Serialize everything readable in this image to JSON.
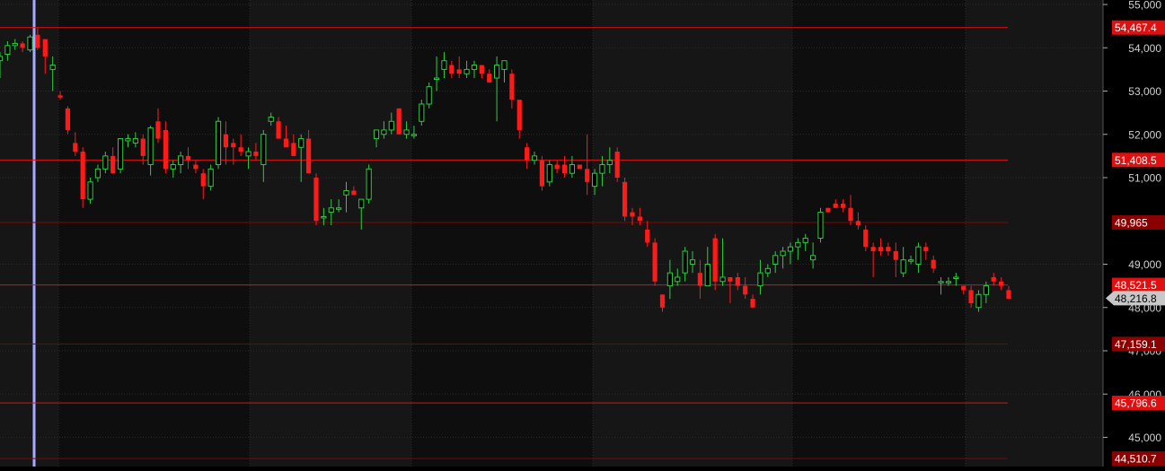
{
  "chart_data": {
    "type": "candlestick",
    "title": "",
    "xlabel": "",
    "ylabel": "",
    "ylim": [
      44500,
      55000
    ],
    "grid": true,
    "y_ticks": [
      {
        "value": 55000,
        "label": "55,000"
      },
      {
        "value": 54000,
        "label": "54,000"
      },
      {
        "value": 53000,
        "label": "53,000"
      },
      {
        "value": 52000,
        "label": "52,000"
      },
      {
        "value": 51000,
        "label": "51,000"
      },
      {
        "value": 49000,
        "label": "49,000"
      },
      {
        "value": 48000,
        "label": "48,000"
      },
      {
        "value": 47000,
        "label": "47,000"
      },
      {
        "value": 46000,
        "label": "46,000"
      },
      {
        "value": 45000,
        "label": "45,000"
      }
    ],
    "horizontal_levels": [
      {
        "value": 54467,
        "label": "54,467.4",
        "color": "#e01010"
      },
      {
        "value": 51408,
        "label": "51,408.5",
        "color": "#e01010"
      },
      {
        "value": 49965,
        "label": "49,965",
        "color": "#8b0000"
      },
      {
        "value": 48521,
        "label": "48,521.5",
        "color": "#e01010"
      },
      {
        "value": 47159,
        "label": "47,159.1",
        "color": "#8b0000"
      },
      {
        "value": 45796,
        "label": "45,796.6",
        "color": "#e01010"
      },
      {
        "value": 44510,
        "label": "44,510.7",
        "color": "#8b0000"
      }
    ],
    "last_price": {
      "value": 48216,
      "label": "48,216.8"
    },
    "candles": [
      [
        53700,
        53900,
        53300,
        53800
      ],
      [
        53850,
        54150,
        53700,
        54050
      ],
      [
        54050,
        54200,
        53950,
        54100
      ],
      [
        54100,
        54150,
        53900,
        54000
      ],
      [
        53950,
        54300,
        53900,
        54250
      ],
      [
        54300,
        54450,
        53950,
        54000
      ],
      [
        54200,
        54150,
        53400,
        53800
      ],
      [
        53500,
        53800,
        53000,
        53600
      ],
      [
        52900,
        53000,
        52800,
        52850
      ],
      [
        52600,
        52650,
        52000,
        52100
      ],
      [
        51800,
        52050,
        51500,
        51600
      ],
      [
        51600,
        51700,
        50300,
        50500
      ],
      [
        50500,
        51000,
        50400,
        50900
      ],
      [
        51000,
        51300,
        50900,
        51200
      ],
      [
        51200,
        51600,
        51100,
        51500
      ],
      [
        51500,
        51700,
        51100,
        51100
      ],
      [
        51200,
        51900,
        51100,
        51900
      ],
      [
        51850,
        52000,
        51700,
        51900
      ],
      [
        51800,
        52050,
        51700,
        51900
      ],
      [
        51900,
        52000,
        51300,
        51500
      ],
      [
        51300,
        52200,
        51050,
        52150
      ],
      [
        52300,
        52600,
        51800,
        51900
      ],
      [
        52100,
        52300,
        51100,
        51200
      ],
      [
        51200,
        51400,
        51000,
        51300
      ],
      [
        51300,
        51600,
        51100,
        51500
      ],
      [
        51500,
        51700,
        51200,
        51400
      ],
      [
        51300,
        51400,
        51100,
        51200
      ],
      [
        51100,
        51200,
        50500,
        50800
      ],
      [
        50800,
        51300,
        50700,
        51200
      ],
      [
        51300,
        52400,
        51200,
        52300
      ],
      [
        52000,
        52300,
        51300,
        51700
      ],
      [
        51800,
        51900,
        51300,
        51700
      ],
      [
        51700,
        52000,
        51500,
        51600
      ],
      [
        51500,
        51700,
        51200,
        51600
      ],
      [
        51600,
        51800,
        51400,
        51500
      ],
      [
        51300,
        52100,
        50900,
        52000
      ],
      [
        52300,
        52500,
        52200,
        52400
      ],
      [
        52300,
        52400,
        51900,
        51900
      ],
      [
        51900,
        52200,
        51700,
        51700
      ],
      [
        51800,
        52000,
        51500,
        51500
      ],
      [
        51700,
        52000,
        50900,
        51900
      ],
      [
        51900,
        52100,
        51100,
        51100
      ],
      [
        51000,
        51100,
        49900,
        50000
      ],
      [
        50100,
        50300,
        49900,
        50100
      ],
      [
        50200,
        50500,
        49900,
        50300
      ],
      [
        50300,
        50500,
        50200,
        50300
      ],
      [
        50600,
        50900,
        50200,
        50700
      ],
      [
        50700,
        50800,
        50600,
        50600
      ],
      [
        50300,
        50400,
        49800,
        50500
      ],
      [
        50500,
        51300,
        50400,
        51200
      ],
      [
        51900,
        52100,
        51700,
        52100
      ],
      [
        52000,
        52300,
        51900,
        52100
      ],
      [
        52100,
        52500,
        52000,
        52300
      ],
      [
        52600,
        52400,
        52100,
        52000
      ],
      [
        52000,
        52300,
        51900,
        52100
      ],
      [
        52000,
        52200,
        51900,
        52000
      ],
      [
        52300,
        52800,
        52200,
        52700
      ],
      [
        52700,
        53200,
        52600,
        53100
      ],
      [
        53300,
        53800,
        53000,
        53300
      ],
      [
        53500,
        53900,
        53300,
        53700
      ],
      [
        53600,
        53700,
        53300,
        53400
      ],
      [
        53500,
        53800,
        53300,
        53400
      ],
      [
        53400,
        53700,
        53300,
        53500
      ],
      [
        53500,
        53700,
        53300,
        53600
      ],
      [
        53600,
        53600,
        53300,
        53400
      ],
      [
        53400,
        53500,
        53200,
        53200
      ],
      [
        53300,
        53800,
        52300,
        53600
      ],
      [
        53500,
        53700,
        53200,
        53700
      ],
      [
        53400,
        53500,
        52600,
        52800
      ],
      [
        52800,
        52600,
        51900,
        52100
      ],
      [
        51700,
        51800,
        51200,
        51400
      ],
      [
        51400,
        51600,
        51300,
        51500
      ],
      [
        51400,
        51500,
        50700,
        50800
      ],
      [
        50900,
        51400,
        50800,
        51300
      ],
      [
        51300,
        51400,
        51100,
        51200
      ],
      [
        51300,
        51500,
        51000,
        51100
      ],
      [
        51100,
        51500,
        51000,
        51300
      ],
      [
        51300,
        51300,
        51200,
        51200
      ],
      [
        51200,
        52000,
        50600,
        50900
      ],
      [
        50800,
        51200,
        50600,
        51100
      ],
      [
        51100,
        51500,
        50800,
        51300
      ],
      [
        51300,
        51700,
        51100,
        51400
      ],
      [
        51600,
        51700,
        50900,
        51000
      ],
      [
        50900,
        51000,
        50000,
        50100
      ],
      [
        50200,
        50300,
        49900,
        50100
      ],
      [
        50100,
        50300,
        49900,
        50000
      ],
      [
        49800,
        50000,
        49400,
        49500
      ],
      [
        49500,
        49600,
        48500,
        48600
      ],
      [
        48300,
        48300,
        47900,
        48000
      ],
      [
        48500,
        49100,
        48200,
        48800
      ],
      [
        48600,
        48900,
        48500,
        48700
      ],
      [
        48800,
        49400,
        48600,
        49300
      ],
      [
        49000,
        49300,
        48800,
        49100
      ],
      [
        48800,
        49100,
        48200,
        48500
      ],
      [
        48500,
        49400,
        48500,
        49000
      ],
      [
        49600,
        49700,
        48400,
        48600
      ],
      [
        48600,
        49600,
        48500,
        48700
      ],
      [
        48700,
        48700,
        48100,
        48600
      ],
      [
        48700,
        48800,
        48400,
        48500
      ],
      [
        48500,
        48700,
        48200,
        48300
      ],
      [
        48200,
        48300,
        48000,
        48000
      ],
      [
        48500,
        49100,
        48300,
        48800
      ],
      [
        48800,
        49000,
        48700,
        48900
      ],
      [
        49000,
        49300,
        48800,
        49200
      ],
      [
        49200,
        49400,
        48900,
        49300
      ],
      [
        49300,
        49500,
        49000,
        49400
      ],
      [
        49400,
        49600,
        49100,
        49500
      ],
      [
        49500,
        49700,
        49300,
        49600
      ],
      [
        49100,
        49500,
        48900,
        49200
      ],
      [
        49600,
        50300,
        49500,
        50200
      ],
      [
        50300,
        50300,
        50200,
        50200
      ],
      [
        50400,
        50500,
        50300,
        50300
      ],
      [
        50400,
        50500,
        50200,
        50300
      ],
      [
        50300,
        50600,
        49900,
        50000
      ],
      [
        50000,
        50200,
        49800,
        49900
      ],
      [
        49800,
        49900,
        49300,
        49400
      ],
      [
        49400,
        49500,
        48700,
        49300
      ],
      [
        49400,
        49600,
        49200,
        49300
      ],
      [
        49400,
        49500,
        49200,
        49300
      ],
      [
        49300,
        49500,
        48700,
        49100
      ],
      [
        48800,
        49400,
        48700,
        49100
      ],
      [
        49100,
        49200,
        49000,
        49100
      ],
      [
        49000,
        49500,
        48800,
        49400
      ],
      [
        49400,
        49500,
        49100,
        49300
      ],
      [
        49100,
        49200,
        48800,
        48900
      ],
      [
        48600,
        48700,
        48300,
        48600
      ],
      [
        48600,
        48700,
        48500,
        48600
      ],
      [
        48700,
        48800,
        48500,
        48700
      ],
      [
        48500,
        48500,
        48300,
        48400
      ],
      [
        48400,
        48500,
        48000,
        48100
      ],
      [
        48000,
        48400,
        47900,
        48300
      ],
      [
        48300,
        48600,
        48100,
        48500
      ],
      [
        48700,
        48800,
        48500,
        48600
      ],
      [
        48600,
        48700,
        48400,
        48500
      ],
      [
        48400,
        48500,
        48200,
        48200
      ]
    ]
  }
}
